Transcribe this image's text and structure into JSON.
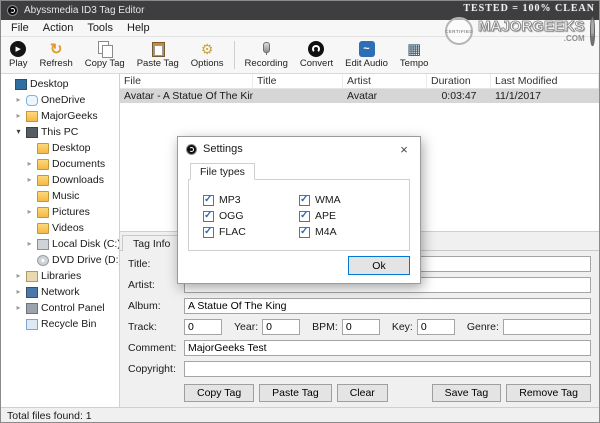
{
  "window": {
    "title": "Abyssmedia ID3 Tag Editor"
  },
  "menu": {
    "items": [
      {
        "label": "File"
      },
      {
        "label": "Action"
      },
      {
        "label": "Tools"
      },
      {
        "label": "Help"
      }
    ]
  },
  "toolbar": {
    "group1": [
      {
        "label": "Play",
        "icon": "play-icon"
      },
      {
        "label": "Refresh",
        "icon": "refresh-icon"
      },
      {
        "label": "Copy Tag",
        "icon": "copy-tag-icon"
      },
      {
        "label": "Paste Tag",
        "icon": "paste-tag-icon"
      },
      {
        "label": "Options",
        "icon": "options-icon"
      }
    ],
    "group2": [
      {
        "label": "Recording",
        "icon": "recording-icon"
      },
      {
        "label": "Convert",
        "icon": "convert-icon"
      },
      {
        "label": "Edit Audio",
        "icon": "edit-audio-icon"
      },
      {
        "label": "Tempo",
        "icon": "tempo-icon"
      }
    ]
  },
  "tree": {
    "items": [
      {
        "label": "Desktop",
        "icon": "desktop-icon",
        "level": 0,
        "expand": "leaf"
      },
      {
        "label": "OneDrive",
        "icon": "onedrive-icon",
        "level": 1,
        "expand": "collapsed"
      },
      {
        "label": "MajorGeeks",
        "icon": "user-folder-icon",
        "level": 1,
        "expand": "collapsed"
      },
      {
        "label": "This PC",
        "icon": "computer-icon",
        "level": 1,
        "expand": "expanded"
      },
      {
        "label": "Desktop",
        "icon": "folder-desktop-icon",
        "level": 2,
        "expand": "leaf"
      },
      {
        "label": "Documents",
        "icon": "folder-icon",
        "level": 2,
        "expand": "collapsed"
      },
      {
        "label": "Downloads",
        "icon": "folder-icon",
        "level": 2,
        "expand": "collapsed"
      },
      {
        "label": "Music",
        "icon": "folder-icon",
        "level": 2,
        "expand": "leaf"
      },
      {
        "label": "Pictures",
        "icon": "folder-icon",
        "level": 2,
        "expand": "collapsed"
      },
      {
        "label": "Videos",
        "icon": "folder-icon",
        "level": 2,
        "expand": "leaf"
      },
      {
        "label": "Local Disk (C:)",
        "icon": "disk-icon",
        "level": 2,
        "expand": "collapsed"
      },
      {
        "label": "DVD Drive (D:)",
        "icon": "dvd-icon",
        "level": 2,
        "expand": "leaf"
      },
      {
        "label": "Libraries",
        "icon": "libraries-icon",
        "level": 1,
        "expand": "collapsed"
      },
      {
        "label": "Network",
        "icon": "network-icon",
        "level": 1,
        "expand": "collapsed"
      },
      {
        "label": "Control Panel",
        "icon": "control-panel-icon",
        "level": 1,
        "expand": "collapsed"
      },
      {
        "label": "Recycle Bin",
        "icon": "recycle-bin-icon",
        "level": 1,
        "expand": "leaf"
      }
    ]
  },
  "file_list": {
    "columns": [
      {
        "label": "File"
      },
      {
        "label": "Title"
      },
      {
        "label": "Artist"
      },
      {
        "label": "Duration"
      },
      {
        "label": "Last Modified"
      }
    ],
    "rows": [
      {
        "file": "Avatar - A Statue Of The King....",
        "title": "",
        "artist": "Avatar",
        "duration": "0:03:47",
        "modified": "11/1/2017",
        "selected": true
      }
    ]
  },
  "tag_panel": {
    "tab": "Tag Info",
    "labels": {
      "title": "Title:",
      "artist": "Artist:",
      "album": "Album:",
      "track": "Track:",
      "year": "Year:",
      "bpm": "BPM:",
      "key": "Key:",
      "genre": "Genre:",
      "comment": "Comment:",
      "copyright": "Copyright:"
    },
    "values": {
      "title": "",
      "artist": "",
      "album": "A Statue Of The King",
      "track": "0",
      "year": "0",
      "bpm": "0",
      "key": "0",
      "genre": "",
      "comment": "MajorGeeks Test",
      "copyright": ""
    },
    "buttons": {
      "copy": "Copy Tag",
      "paste": "Paste Tag",
      "clear": "Clear",
      "save": "Save Tag",
      "remove": "Remove Tag"
    }
  },
  "dialog": {
    "title": "Settings",
    "tab": "File types",
    "filetypes": [
      {
        "label": "MP3",
        "checked": true
      },
      {
        "label": "OGG",
        "checked": true
      },
      {
        "label": "FLAC",
        "checked": true
      },
      {
        "label": "WMA",
        "checked": true
      },
      {
        "label": "APE",
        "checked": true
      },
      {
        "label": "M4A",
        "checked": true
      }
    ],
    "ok": "Ok",
    "close": "×"
  },
  "status": {
    "text": "Total files found: 1"
  },
  "watermark": {
    "tested": "TESTED = 100% CLEAN",
    "badge": "CERTIFIED",
    "brand": "MAJORGEEKS",
    "domain": ".COM"
  }
}
